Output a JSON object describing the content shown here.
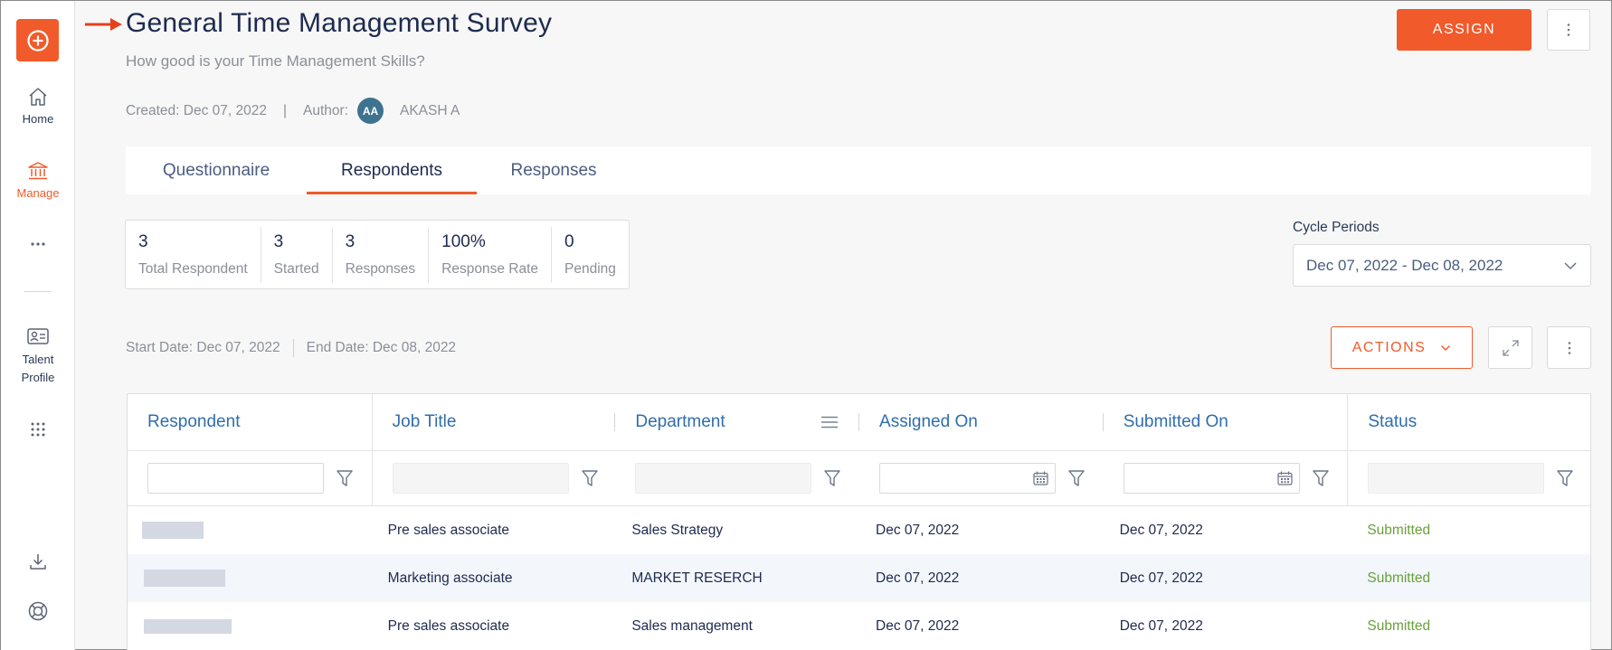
{
  "sidebar": {
    "items": [
      {
        "label": "Home",
        "icon": "home-icon"
      },
      {
        "label": "Manage",
        "icon": "bank-icon"
      },
      {
        "label": "Talent Profile",
        "label1": "Talent",
        "label2": "Profile",
        "icon": "id-card-icon"
      }
    ]
  },
  "header": {
    "title": "General Time Management Survey",
    "subtitle": "How good is your Time Management Skills?",
    "created": "Created: Dec 07, 2022",
    "separator": "|",
    "author_label": "Author:",
    "author_initials": "AA",
    "author_name": "AKASH A",
    "assign_label": "ASSIGN"
  },
  "tabs": [
    {
      "label": "Questionnaire",
      "active": false
    },
    {
      "label": "Respondents",
      "active": true
    },
    {
      "label": "Responses",
      "active": false
    }
  ],
  "stats": [
    {
      "value": "3",
      "label": "Total Respondent"
    },
    {
      "value": "3",
      "label": "Started"
    },
    {
      "value": "3",
      "label": "Responses"
    },
    {
      "value": "100%",
      "label": "Response Rate"
    },
    {
      "value": "0",
      "label": "Pending"
    }
  ],
  "cycle": {
    "label": "Cycle Periods",
    "value": "Dec 07, 2022 - Dec 08, 2022"
  },
  "dates": {
    "start": "Start Date: Dec 07, 2022",
    "end": "End Date: Dec 08, 2022"
  },
  "toolbar": {
    "actions_label": "ACTIONS"
  },
  "table": {
    "columns": [
      "Respondent",
      "Job Title",
      "Department",
      "Assigned On",
      "Submitted On",
      "Status"
    ],
    "rows": [
      {
        "job_title": "Pre sales associate",
        "department": "Sales Strategy",
        "assigned_on": "Dec 07, 2022",
        "submitted_on": "Dec 07, 2022",
        "status": "Submitted"
      },
      {
        "job_title": "Marketing associate",
        "department": "MARKET RESERCH",
        "assigned_on": "Dec 07, 2022",
        "submitted_on": "Dec 07, 2022",
        "status": "Submitted"
      },
      {
        "job_title": "Pre sales associate",
        "department": "Sales management",
        "assigned_on": "Dec 07, 2022",
        "submitted_on": "Dec 07, 2022",
        "status": "Submitted"
      }
    ]
  },
  "colors": {
    "accent": "#f15a2b",
    "header_link": "#2f6ead",
    "status_submitted": "#6aa03a",
    "avatar": "#3e7390"
  }
}
